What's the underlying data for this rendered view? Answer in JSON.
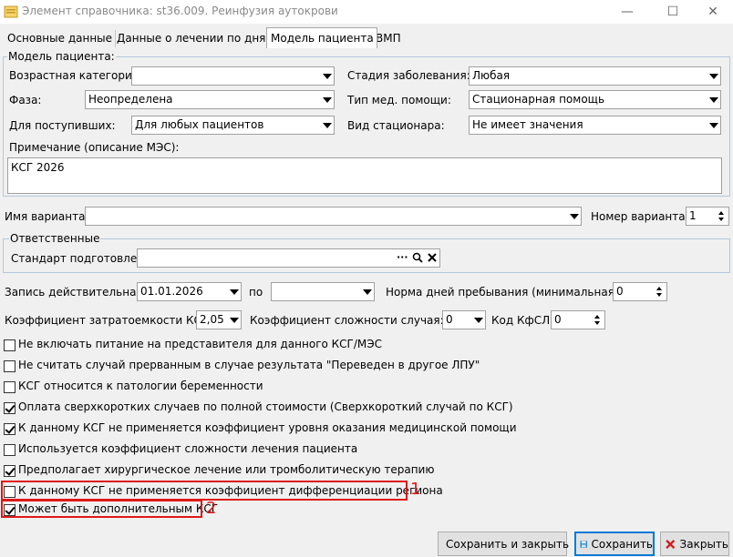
{
  "window": {
    "title": "Элемент справочника: st36.009. Реинфузия аутокрови",
    "minimize": "—",
    "maximize": "☐",
    "close": "✕"
  },
  "tabs": [
    {
      "label": "Основные данные"
    },
    {
      "label": "Данные о лечении по дням"
    },
    {
      "label": "Модель пациента"
    },
    {
      "label": "ВМП"
    }
  ],
  "model": {
    "legend": "Модель пациента:",
    "age_category": {
      "label": "Возрастная категория:",
      "value": ""
    },
    "stage": {
      "label": "Стадия заболевания:",
      "value": "Любая"
    },
    "phase": {
      "label": "Фаза:",
      "value": "Неопределена"
    },
    "care_type": {
      "label": "Тип мед. помощи:",
      "value": "Стационарная помощь"
    },
    "admission": {
      "label": "Для поступивших:",
      "value": "Для любых пациентов"
    },
    "hospital_type": {
      "label": "Вид стационара:",
      "value": "Не имеет значения"
    },
    "note_label": "Примечание (описание МЭС):",
    "note_value": "КСГ 2026"
  },
  "variant": {
    "name_label": "Имя варианта:",
    "name_value": "",
    "number_label": "Номер варианта:",
    "number_value": "1"
  },
  "responsible": {
    "legend": "Ответственные",
    "standard_label": "Стандарт подготовлен:",
    "standard_value": "",
    "dots": "···",
    "search": "🔍",
    "clear": "✕"
  },
  "validity": {
    "from_label": "Запись действительна с:",
    "from_value": "01.01.2026",
    "to_label": "по",
    "to_value": "",
    "norm_label": "Норма дней пребывания (минимальная):",
    "norm_value": "0"
  },
  "coef": {
    "cost_label": "Коэффициент затратоемкости КСГ:",
    "cost_value": "2,05",
    "complexity_label": "Коэффициент сложности случая:",
    "complexity_value": "0",
    "kfsl_label": "Код КфСЛ:",
    "kfsl_value": "0"
  },
  "checkboxes": [
    {
      "label": "Не включать питание на представителя для данного КСГ/МЭС",
      "checked": false
    },
    {
      "label": "Не считать случай прерванным в случае результата \"Переведен в другое ЛПУ\"",
      "checked": false
    },
    {
      "label": "КСГ относится к патологии беременности",
      "checked": false
    },
    {
      "label": "Оплата сверхкоротких случаев по полной стоимости (Сверхкороткий случай по КСГ)",
      "checked": true
    },
    {
      "label": "К данному КСГ не применяется коэффициент уровня оказания медицинской помощи",
      "checked": true
    },
    {
      "label": "Используется коэффициент сложности лечения пациента",
      "checked": false
    },
    {
      "label": "Предполагает хирургическое лечение или тромболитическую терапию",
      "checked": true
    },
    {
      "label": "К данному КСГ не применяется коэффициент дифференциации региона",
      "checked": false
    },
    {
      "label": "Может быть дополнительным КСГ",
      "checked": true
    }
  ],
  "annotations": {
    "one": "1",
    "two": "2",
    "color": "#e01818"
  },
  "buttons": {
    "save_close": "Сохранить и закрыть",
    "save": "Сохранить",
    "close": "Закрыть"
  }
}
